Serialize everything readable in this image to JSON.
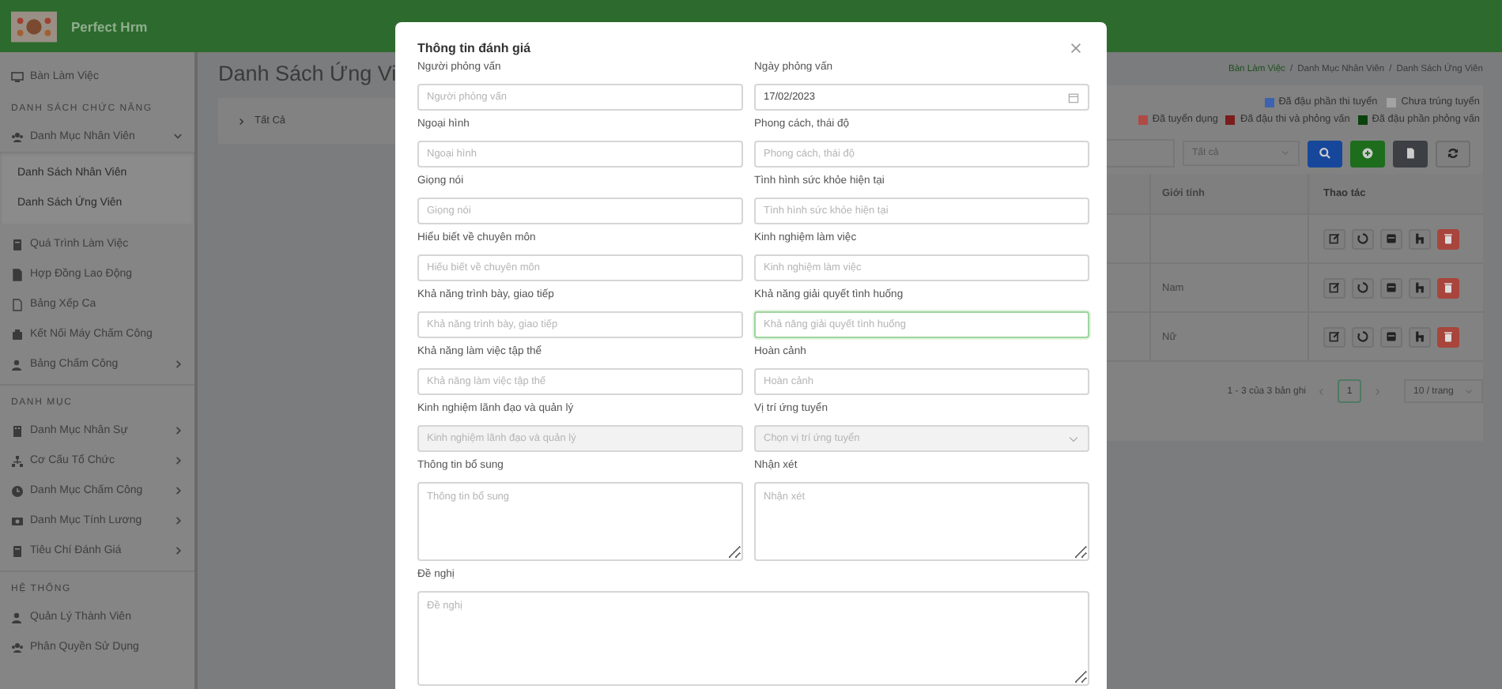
{
  "header": {
    "app_name": "Perfect Hrm"
  },
  "sidebar": [
    {
      "kind": "item",
      "label": "Bàn Làm Việc"
    },
    {
      "kind": "section",
      "label": "DANH SÁCH CHỨC NĂNG"
    },
    {
      "kind": "item",
      "label": "Danh Mục Nhân Viên",
      "expanded": true,
      "children": [
        {
          "label": "Danh Sách Nhân Viên"
        },
        {
          "label": "Danh Sách Ứng Viên"
        }
      ]
    },
    {
      "kind": "item",
      "label": "Quá Trình Làm Việc"
    },
    {
      "kind": "item",
      "label": "Hợp Đồng Lao Động"
    },
    {
      "kind": "item",
      "label": "Bảng Xếp Ca"
    },
    {
      "kind": "item",
      "label": "Kết Nối Máy Chấm Công"
    },
    {
      "kind": "item",
      "label": "Bảng Chấm Công",
      "expanded": false
    },
    {
      "kind": "section",
      "label": "DANH MỤC"
    },
    {
      "kind": "item",
      "label": "Danh Mục Nhân Sự",
      "expanded": false
    },
    {
      "kind": "item",
      "label": "Cơ Cấu Tổ Chức",
      "expanded": false
    },
    {
      "kind": "item",
      "label": "Danh Mục Chấm Công",
      "expanded": false
    },
    {
      "kind": "item",
      "label": "Danh Mục Tính Lương",
      "expanded": false
    },
    {
      "kind": "item",
      "label": "Tiêu Chí Đánh Giá",
      "expanded": false
    },
    {
      "kind": "section",
      "label": "HỆ THỐNG"
    },
    {
      "kind": "item",
      "label": "Quản Lý Thành Viên"
    },
    {
      "kind": "item",
      "label": "Phân Quyền Sử Dụng"
    }
  ],
  "page": {
    "title": "Danh Sách Ứng Vi",
    "filter_chip": "Tất Cả",
    "breadcrumb": [
      {
        "kind": "link",
        "text": "Bàn Làm Việc"
      },
      {
        "kind": "separator",
        "text": "/"
      },
      {
        "kind": "link",
        "text": "Danh Mục Nhân Viên"
      },
      {
        "kind": "separator",
        "text": "/"
      },
      {
        "kind": "link",
        "text": "Danh Sách Ứng Viên"
      }
    ]
  },
  "legend": [
    {
      "label": "Đã đậu phần thi tuyển",
      "color": "#3d63b0"
    },
    {
      "label": "Chưa trúng tuyển",
      "color": "#a3a3a3"
    },
    {
      "label": "Đã tuyển dụng",
      "color": "#b04a44"
    },
    {
      "label": "Đã đậu thi và phỏng vấn",
      "color": "#7a1c1c"
    },
    {
      "label": "Đã đậu phần phỏng vấn",
      "color": "#0b420b"
    }
  ],
  "toolbar": {
    "status_filter": "Tất cả"
  },
  "table": {
    "columns": [
      "Giới tính",
      "Thao tác"
    ],
    "rows": [
      {},
      {
        "gender": "Nam"
      },
      {
        "gender": "Nữ"
      }
    ]
  },
  "pagination": {
    "summary": "1 - 3 của 3 bản ghi",
    "pages": [
      {
        "label": "1",
        "selected": true
      }
    ],
    "page_size": "10 / trang"
  },
  "modal": {
    "title": "Thông tin đánh giá",
    "fields": [
      {
        "kind": "text",
        "label": "Người phỏng vấn",
        "placeholder": "Người phỏng vấn",
        "disabled": false,
        "focused": false
      },
      {
        "kind": "date",
        "label": "Ngày phỏng vấn",
        "value": "17/02/2023",
        "disabled": false,
        "focused": false
      },
      {
        "kind": "text",
        "label": "Ngoại hình",
        "placeholder": "Ngoại hình",
        "disabled": false,
        "focused": false
      },
      {
        "kind": "text",
        "label": "Phong cách, thái độ",
        "placeholder": "Phong cách, thái độ",
        "disabled": false,
        "focused": false
      },
      {
        "kind": "text",
        "label": "Giọng nói",
        "placeholder": "Giọng nói",
        "disabled": false,
        "focused": false
      },
      {
        "kind": "text",
        "label": "Tình hình sức khỏe hiện tại",
        "placeholder": "Tình hình sức khỏe hiện tại",
        "disabled": false,
        "focused": false
      },
      {
        "kind": "text",
        "label": "Hiểu biết về chuyên môn",
        "placeholder": "Hiểu biết về chuyên môn",
        "disabled": false,
        "focused": false
      },
      {
        "kind": "text",
        "label": "Kinh nghiệm làm việc",
        "placeholder": "Kinh nghiệm làm việc",
        "disabled": false,
        "focused": false
      },
      {
        "kind": "text",
        "label": "Khả năng trình bày, giao tiếp",
        "placeholder": "Khả năng trình bày, giao tiếp",
        "disabled": false,
        "focused": false
      },
      {
        "kind": "text",
        "label": "Khả năng giải quyết tình huống",
        "placeholder": "Khả năng giải quyết tình huống",
        "disabled": false,
        "focused": true
      },
      {
        "kind": "text",
        "label": "Khả năng làm việc tập thể",
        "placeholder": "Khả năng làm việc tập thể",
        "disabled": false,
        "focused": false
      },
      {
        "kind": "text",
        "label": "Hoàn cảnh",
        "placeholder": "Hoàn cảnh",
        "disabled": false,
        "focused": false
      },
      {
        "kind": "text",
        "label": "Kinh nghiệm lãnh đạo và quản lý",
        "placeholder": "Kinh nghiệm lãnh đạo và quản lý",
        "disabled": true,
        "focused": false
      },
      {
        "kind": "select",
        "label": "Vị trí ứng tuyển",
        "placeholder": "Chọn vị trí ứng tuyển",
        "disabled": true,
        "focused": false
      },
      {
        "kind": "textarea",
        "label": "Thông tin bổ sung",
        "placeholder": "Thông tin bổ sung",
        "disabled": false,
        "focused": false
      },
      {
        "kind": "textarea",
        "label": "Nhận xét",
        "placeholder": "Nhận xét",
        "disabled": false,
        "focused": false
      },
      {
        "kind": "textarea_wide",
        "label": "Đề nghị",
        "placeholder": "Đề nghị",
        "disabled": false,
        "focused": false
      }
    ]
  }
}
